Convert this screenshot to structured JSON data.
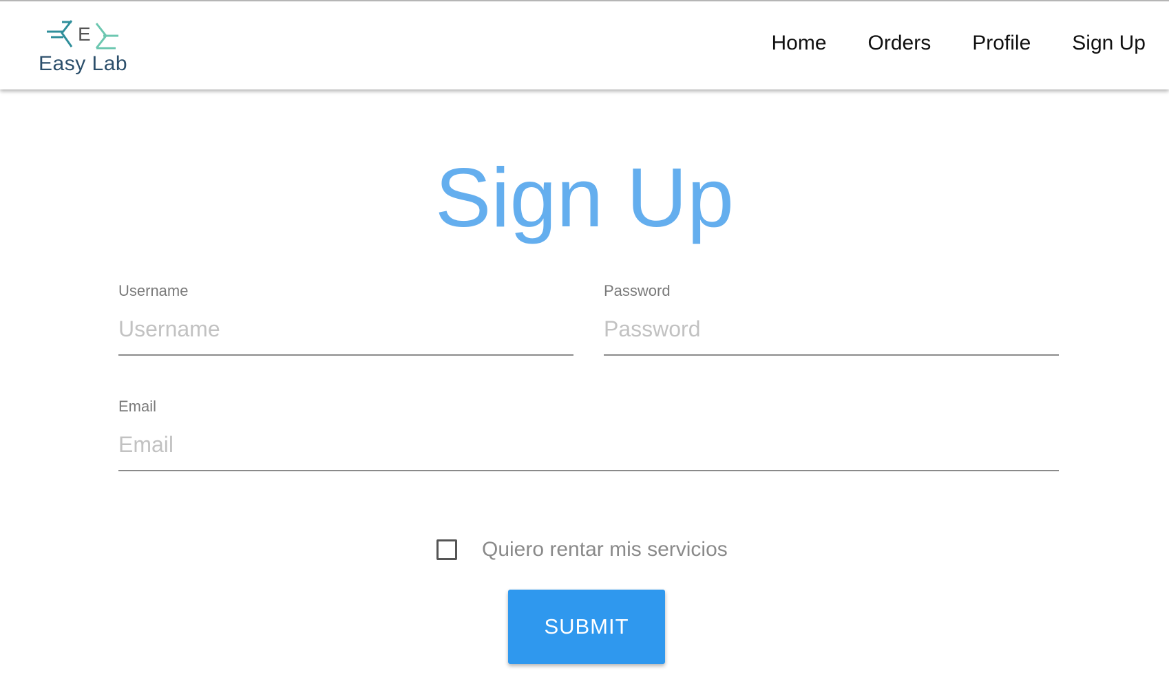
{
  "header": {
    "logo_text": "Easy Lab",
    "logo_mark_letter": "E",
    "nav": [
      {
        "label": "Home"
      },
      {
        "label": "Orders"
      },
      {
        "label": "Profile"
      },
      {
        "label": "Sign Up"
      }
    ]
  },
  "form": {
    "title": "Sign Up",
    "username": {
      "label": "Username",
      "placeholder": "Username",
      "value": ""
    },
    "password": {
      "label": "Password",
      "placeholder": "Password",
      "value": ""
    },
    "email": {
      "label": "Email",
      "placeholder": "Email",
      "value": ""
    },
    "checkbox": {
      "label": "Quiero rentar mis servicios",
      "checked": false
    },
    "submit_label": "SUBMIT"
  },
  "colors": {
    "title": "#64aeee",
    "submit_bg": "#2f98ee",
    "logo_teal": "#2f8f9b",
    "logo_green": "#6cc7b0",
    "logo_text": "#2c4f6b"
  }
}
